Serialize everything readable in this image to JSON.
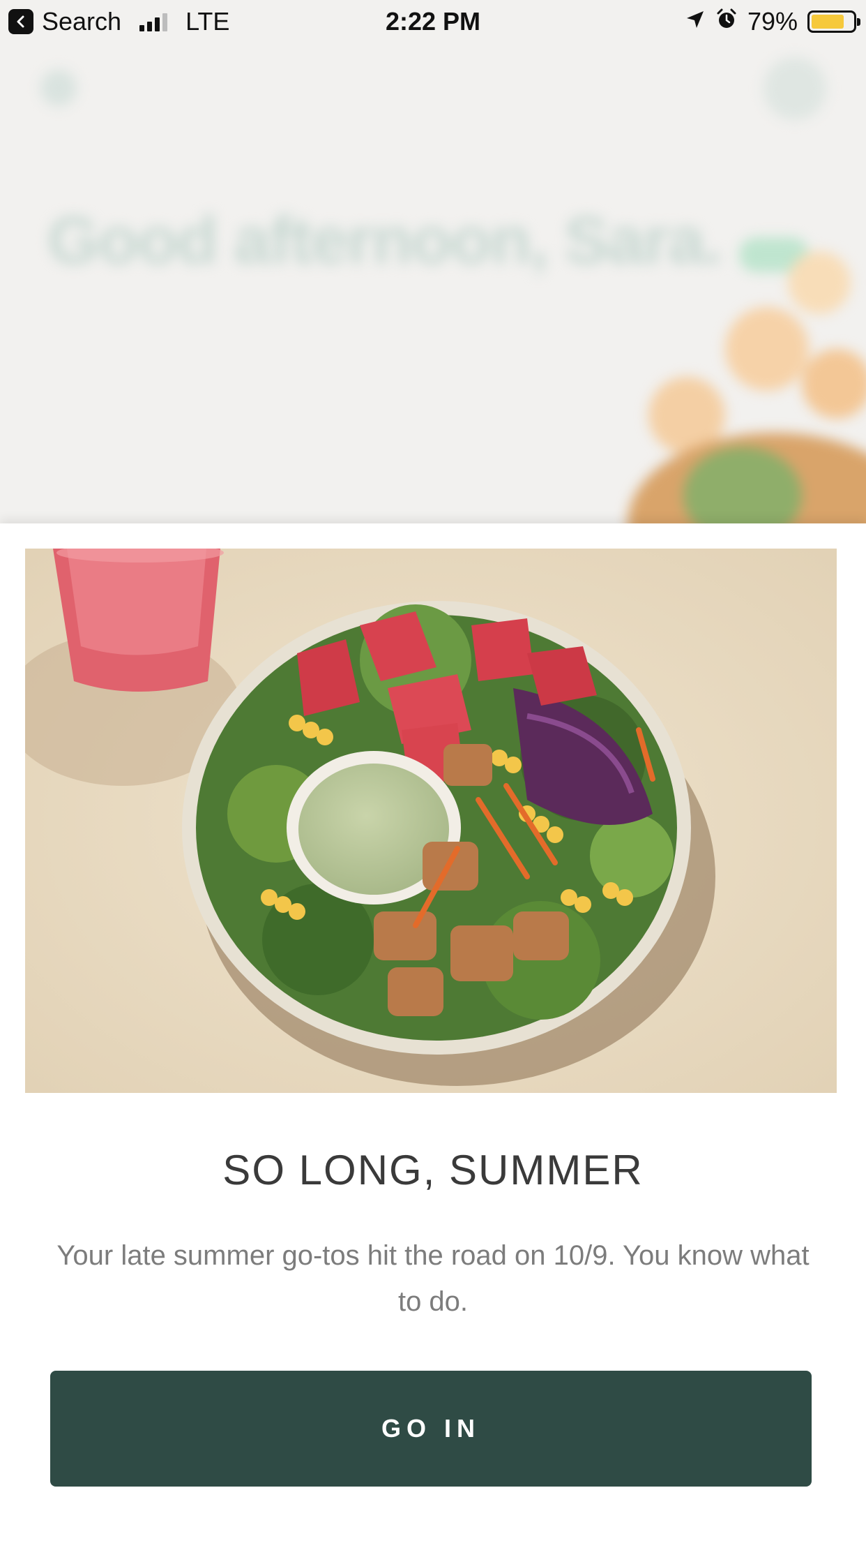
{
  "status_bar": {
    "back_label": "Search",
    "network": "LTE",
    "time": "2:22 PM",
    "battery": "79%",
    "battery_level": 0.79,
    "icons": [
      "back-arrow-icon",
      "signal-icon",
      "location-arrow-icon",
      "alarm-icon",
      "battery-icon"
    ]
  },
  "background": {
    "greeting": "Good afternoon, Sara."
  },
  "modal": {
    "title": "SO LONG, SUMMER",
    "body": "Your late summer go-tos hit the road on 10/9. You know what to do.",
    "cta_label": "GO IN"
  },
  "colors": {
    "cta": "#2f4b45",
    "battery_fill": "#f6c93b",
    "title": "#3a3a3a",
    "body": "#7c7c7c"
  }
}
